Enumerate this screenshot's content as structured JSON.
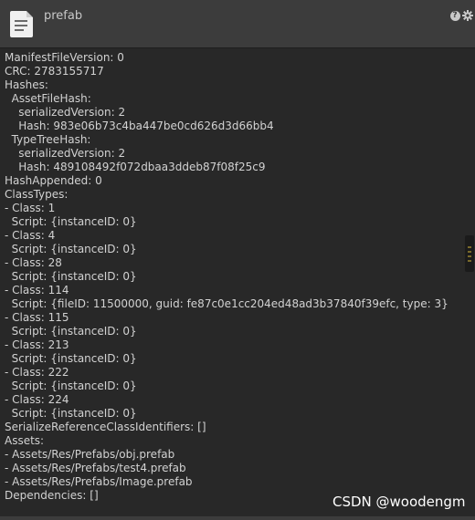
{
  "header": {
    "title": "prefab",
    "icons": [
      "file-icon",
      "help-icon",
      "gear-icon"
    ]
  },
  "lines": [
    "ManifestFileVersion: 0",
    "CRC: 2783155717",
    "Hashes:",
    "  AssetFileHash:",
    "    serializedVersion: 2",
    "    Hash: 983e06b73c4ba447be0cd626d3d66bb4",
    "  TypeTreeHash:",
    "    serializedVersion: 2",
    "    Hash: 489108492f072dbaa3ddeb87f08f25c9",
    "HashAppended: 0",
    "ClassTypes:",
    "- Class: 1",
    "  Script: {instanceID: 0}",
    "- Class: 4",
    "  Script: {instanceID: 0}",
    "- Class: 28",
    "  Script: {instanceID: 0}",
    "- Class: 114",
    "  Script: {fileID: 11500000, guid: fe87c0e1cc204ed48ad3b37840f39efc, type: 3}",
    "- Class: 115",
    "  Script: {instanceID: 0}",
    "- Class: 213",
    "  Script: {instanceID: 0}",
    "- Class: 222",
    "  Script: {instanceID: 0}",
    "- Class: 224",
    "  Script: {instanceID: 0}",
    "SerializeReferenceClassIdentifiers: []",
    "Assets:",
    "- Assets/Res/Prefabs/obj.prefab",
    "- Assets/Res/Prefabs/test4.prefab",
    "- Assets/Res/Prefabs/Image.prefab",
    "Dependencies: []"
  ],
  "watermark": "CSDN @woodengm",
  "colors": {
    "background": "#282828",
    "header": "#3c3c3c",
    "text": "#d2d2d2"
  }
}
